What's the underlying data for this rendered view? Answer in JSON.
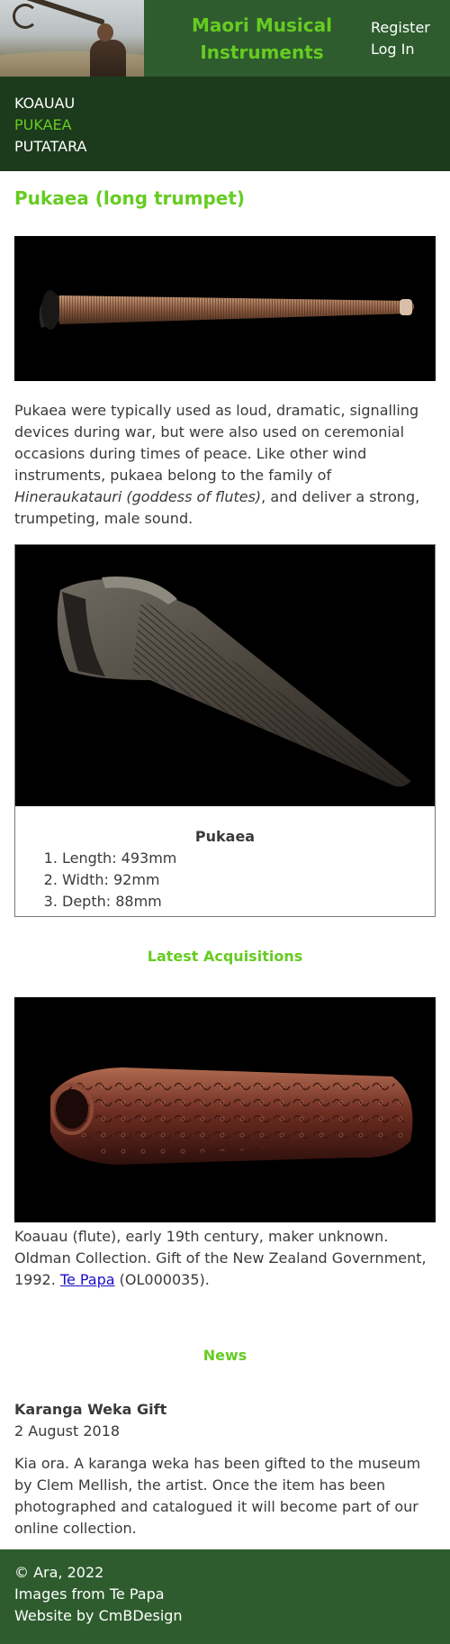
{
  "header": {
    "title_line1": "Maori Musical",
    "title_line2": "Instruments",
    "register_label": "Register",
    "login_label": "Log In"
  },
  "nav": {
    "items": [
      {
        "label": "KOAUAU",
        "active": false
      },
      {
        "label": "PUKAEA",
        "active": true
      },
      {
        "label": "PUTATARA",
        "active": false
      }
    ],
    "active_color": "#66cc22"
  },
  "main": {
    "title": "Pukaea (long trumpet)",
    "intro_part1": "Pukaea were typically used as loud, dramatic, signalling devices during war, but were also used on ceremonial occasions during times of peace. Like other wind instruments, pukaea belong to the family of ",
    "intro_italic": "Hineraukatauri (goddess of flutes)",
    "intro_part2": ", and deliver a strong, trumpeting, male sound.",
    "figure": {
      "caption_title": "Pukaea",
      "specs": [
        "Length: 493mm",
        "Width: 92mm",
        "Depth: 88mm"
      ]
    }
  },
  "latest": {
    "heading": "Latest Acquisitions",
    "caption_text": "Koauau (flute), early 19th century, maker unknown. Oldman Collection. Gift of the New Zealand Government, 1992. ",
    "link_label": "Te Papa",
    "caption_suffix": " (OL000035)."
  },
  "news": {
    "heading": "News",
    "item_title": "Karanga Weka Gift",
    "item_date": "2 August 2018",
    "item_body": "Kia ora. A karanga weka has been gifted to the museum by Clem Mellish, the artist. Once the item has been photographed and catalogued it will become part of our online collection."
  },
  "footer": {
    "copyright": "© Ara, 2022",
    "images_credit": "Images from Te Papa",
    "website_credit": "Website by CmBDesign"
  },
  "colors": {
    "brand_green": "#2e5c2e",
    "nav_dark_green": "#1c3a1c",
    "accent_green": "#66cc22",
    "link_blue": "#1a0dcc"
  }
}
